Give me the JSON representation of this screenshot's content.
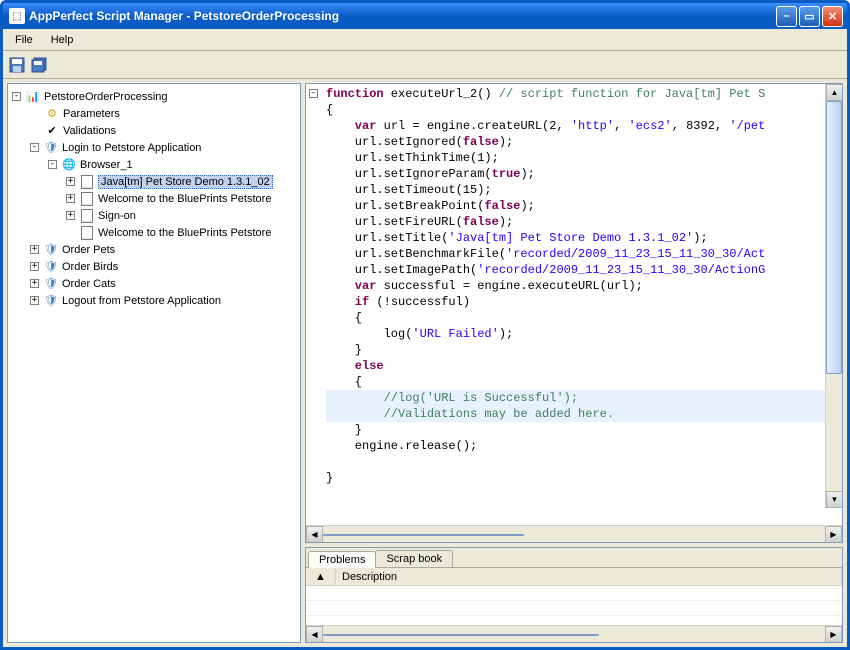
{
  "window": {
    "title": "AppPerfect Script Manager - PetstoreOrderProcessing"
  },
  "menu": {
    "file": "File",
    "help": "Help"
  },
  "tree": {
    "root": "PetstoreOrderProcessing",
    "parameters": "Parameters",
    "validations": "Validations",
    "login": "Login to Petstore Application",
    "browser": "Browser_1",
    "page1": "Java[tm] Pet Store Demo 1.3.1_02",
    "page2": "Welcome to the BluePrints Petstore",
    "page3": "Sign-on",
    "page4": "Welcome to the BluePrints Petstore",
    "order_pets": "Order Pets",
    "order_birds": "Order Birds",
    "order_cats": "Order Cats",
    "logout": "Logout from Petstore Application"
  },
  "code": {
    "l1a": "function",
    "l1b": " executeUrl_2() ",
    "l1c": "// script function for Java[tm] Pet S",
    "l2": "{",
    "l3a": "    var",
    "l3b": " url = engine.createURL(2, ",
    "l3c": "'http'",
    "l3d": ", ",
    "l3e": "'ecs2'",
    "l3f": ", 8392, ",
    "l3g": "'/pet",
    "l4a": "    url.setIgnored(",
    "l4b": "false",
    "l4c": ");",
    "l5": "    url.setThinkTime(1);",
    "l6a": "    url.setIgnoreParam(",
    "l6b": "true",
    "l6c": ");",
    "l7": "    url.setTimeout(15);",
    "l8a": "    url.setBreakPoint(",
    "l8b": "false",
    "l8c": ");",
    "l9a": "    url.setFireURL(",
    "l9b": "false",
    "l9c": ");",
    "l10a": "    url.setTitle(",
    "l10b": "'Java[tm] Pet Store Demo 1.3.1_02'",
    "l10c": ");",
    "l11a": "    url.setBenchmarkFile(",
    "l11b": "'recorded/2009_11_23_15_11_30_30/Act",
    "l12a": "    url.setImagePath(",
    "l12b": "'recorded/2009_11_23_15_11_30_30/ActionG",
    "l13a": "    var",
    "l13b": " successful = engine.executeURL(url);",
    "l14a": "    if",
    "l14b": " (!successful)",
    "l15": "    {",
    "l16a": "        log(",
    "l16b": "'URL Failed'",
    "l16c": ");",
    "l17": "    }",
    "l18": "    else",
    "l19": "    {",
    "l20": "        //log('URL is Successful');",
    "l21": "        //Validations may be added here.",
    "l22": "    }",
    "l23": "    engine.release();",
    "l24": "",
    "l25": "}"
  },
  "tabs": {
    "problems": "Problems",
    "scrapbook": "Scrap book"
  },
  "grid": {
    "col_sort": "▲",
    "col_desc": "Description"
  }
}
